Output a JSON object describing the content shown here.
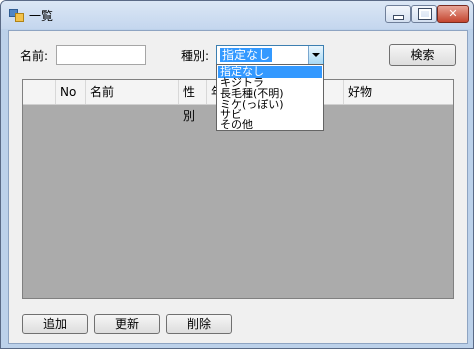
{
  "window": {
    "title": "一覧"
  },
  "form": {
    "name_label": "名前:",
    "name_value": "",
    "type_label": "種別:",
    "type_selected": "指定なし",
    "search_button": "検索"
  },
  "grid": {
    "columns": [
      "No",
      "名前",
      "性別",
      "年",
      "好物"
    ]
  },
  "dropdown": {
    "options": [
      "指定なし",
      "キジトラ",
      "長毛種(不明)",
      "ミケ(っぽい)",
      "サビ",
      "その他"
    ]
  },
  "actions": {
    "add": "追加",
    "update": "更新",
    "delete": "削除"
  }
}
